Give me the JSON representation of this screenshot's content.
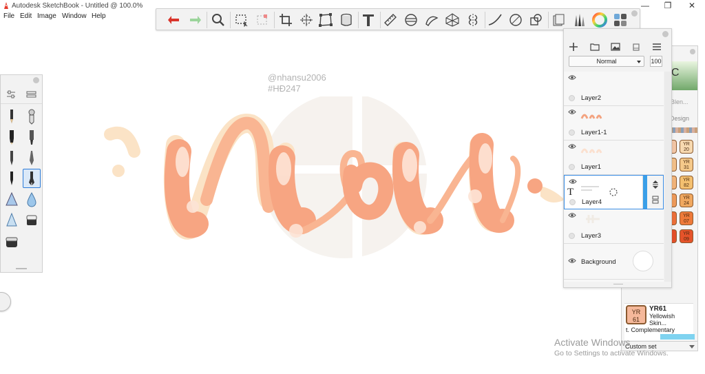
{
  "window": {
    "title": "Autodesk SketchBook - Untitled @ 100.0%",
    "minimize": "—",
    "maximize": "❐",
    "close": "✕"
  },
  "menu": [
    {
      "label": "File"
    },
    {
      "label": "Edit"
    },
    {
      "label": "Image"
    },
    {
      "label": "Window"
    },
    {
      "label": "Help"
    }
  ],
  "toolbar": {
    "tools": [
      "undo-icon",
      "redo-icon",
      "zoom-icon",
      "select-icon",
      "magic-wand-icon",
      "crop-icon",
      "transform-icon",
      "distort-icon",
      "fill-icon",
      "text-icon",
      "ruler-icon",
      "ellipse-guide-icon",
      "french-curve-icon",
      "perspective-icon",
      "symmetry-icon",
      "stroke-icon",
      "shape-icon",
      "layer-copy-icon",
      "copic-library-icon",
      "brush-library-icon",
      "color-wheel-icon",
      "palette-icon"
    ]
  },
  "canvas": {
    "watermark_line1": "@nhansu2006",
    "watermark_line2": "#HĐ247",
    "colors": {
      "peach": "#f6a585",
      "cream": "#fae0c0",
      "circle": "#f2ede6"
    }
  },
  "layers": {
    "blend_mode": "Normal",
    "opacity": "100",
    "items": [
      {
        "name": "Layer2",
        "visible": true
      },
      {
        "name": "Layer1-1",
        "visible": true
      },
      {
        "name": "Layer1",
        "visible": true
      },
      {
        "name": "Layer4",
        "visible": true,
        "selected": true,
        "thumb_text": "@nhansu2006\n#HĐ247"
      },
      {
        "name": "Layer3",
        "visible": true
      },
      {
        "name": "Background",
        "visible": true
      }
    ]
  },
  "copic": {
    "header_letter": "C",
    "blend_label": "s Blen...",
    "design_label": "Design",
    "swatches": [
      {
        "code": "YR\n20",
        "color": "#f7d9b0"
      },
      {
        "code": "YR\n31",
        "color": "#f5c98a"
      },
      {
        "code": "YR\n82",
        "color": "#f4c070"
      },
      {
        "code": "YR\n24",
        "color": "#f0a860"
      },
      {
        "code": "YR\n07",
        "color": "#ee7a3a"
      },
      {
        "code": "YR\n09",
        "color": "#e5532a"
      }
    ],
    "selected": {
      "code": "YR\n61",
      "name": "YR61",
      "description": "Yellowish Skin...",
      "complementary": "t. Complementary",
      "color": "#f5b89a"
    },
    "custom_set": "Custom set"
  },
  "activation": {
    "line1": "Activate Windows",
    "line2": "Go to Settings to activate Windows."
  }
}
